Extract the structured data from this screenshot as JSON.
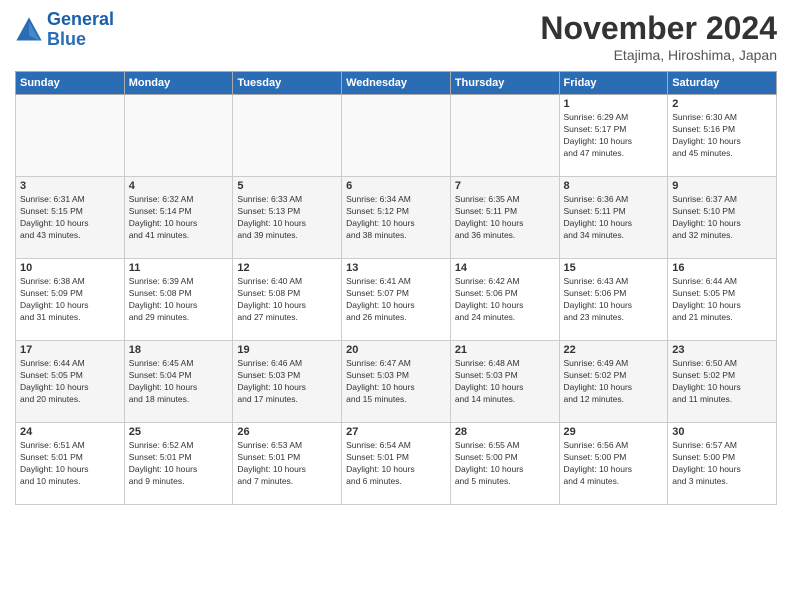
{
  "header": {
    "logo_line1": "General",
    "logo_line2": "Blue",
    "title": "November 2024",
    "subtitle": "Etajima, Hiroshima, Japan"
  },
  "days_of_week": [
    "Sunday",
    "Monday",
    "Tuesday",
    "Wednesday",
    "Thursday",
    "Friday",
    "Saturday"
  ],
  "weeks": [
    [
      {
        "day": "",
        "info": ""
      },
      {
        "day": "",
        "info": ""
      },
      {
        "day": "",
        "info": ""
      },
      {
        "day": "",
        "info": ""
      },
      {
        "day": "",
        "info": ""
      },
      {
        "day": "1",
        "info": "Sunrise: 6:29 AM\nSunset: 5:17 PM\nDaylight: 10 hours\nand 47 minutes."
      },
      {
        "day": "2",
        "info": "Sunrise: 6:30 AM\nSunset: 5:16 PM\nDaylight: 10 hours\nand 45 minutes."
      }
    ],
    [
      {
        "day": "3",
        "info": "Sunrise: 6:31 AM\nSunset: 5:15 PM\nDaylight: 10 hours\nand 43 minutes."
      },
      {
        "day": "4",
        "info": "Sunrise: 6:32 AM\nSunset: 5:14 PM\nDaylight: 10 hours\nand 41 minutes."
      },
      {
        "day": "5",
        "info": "Sunrise: 6:33 AM\nSunset: 5:13 PM\nDaylight: 10 hours\nand 39 minutes."
      },
      {
        "day": "6",
        "info": "Sunrise: 6:34 AM\nSunset: 5:12 PM\nDaylight: 10 hours\nand 38 minutes."
      },
      {
        "day": "7",
        "info": "Sunrise: 6:35 AM\nSunset: 5:11 PM\nDaylight: 10 hours\nand 36 minutes."
      },
      {
        "day": "8",
        "info": "Sunrise: 6:36 AM\nSunset: 5:11 PM\nDaylight: 10 hours\nand 34 minutes."
      },
      {
        "day": "9",
        "info": "Sunrise: 6:37 AM\nSunset: 5:10 PM\nDaylight: 10 hours\nand 32 minutes."
      }
    ],
    [
      {
        "day": "10",
        "info": "Sunrise: 6:38 AM\nSunset: 5:09 PM\nDaylight: 10 hours\nand 31 minutes."
      },
      {
        "day": "11",
        "info": "Sunrise: 6:39 AM\nSunset: 5:08 PM\nDaylight: 10 hours\nand 29 minutes."
      },
      {
        "day": "12",
        "info": "Sunrise: 6:40 AM\nSunset: 5:08 PM\nDaylight: 10 hours\nand 27 minutes."
      },
      {
        "day": "13",
        "info": "Sunrise: 6:41 AM\nSunset: 5:07 PM\nDaylight: 10 hours\nand 26 minutes."
      },
      {
        "day": "14",
        "info": "Sunrise: 6:42 AM\nSunset: 5:06 PM\nDaylight: 10 hours\nand 24 minutes."
      },
      {
        "day": "15",
        "info": "Sunrise: 6:43 AM\nSunset: 5:06 PM\nDaylight: 10 hours\nand 23 minutes."
      },
      {
        "day": "16",
        "info": "Sunrise: 6:44 AM\nSunset: 5:05 PM\nDaylight: 10 hours\nand 21 minutes."
      }
    ],
    [
      {
        "day": "17",
        "info": "Sunrise: 6:44 AM\nSunset: 5:05 PM\nDaylight: 10 hours\nand 20 minutes."
      },
      {
        "day": "18",
        "info": "Sunrise: 6:45 AM\nSunset: 5:04 PM\nDaylight: 10 hours\nand 18 minutes."
      },
      {
        "day": "19",
        "info": "Sunrise: 6:46 AM\nSunset: 5:03 PM\nDaylight: 10 hours\nand 17 minutes."
      },
      {
        "day": "20",
        "info": "Sunrise: 6:47 AM\nSunset: 5:03 PM\nDaylight: 10 hours\nand 15 minutes."
      },
      {
        "day": "21",
        "info": "Sunrise: 6:48 AM\nSunset: 5:03 PM\nDaylight: 10 hours\nand 14 minutes."
      },
      {
        "day": "22",
        "info": "Sunrise: 6:49 AM\nSunset: 5:02 PM\nDaylight: 10 hours\nand 12 minutes."
      },
      {
        "day": "23",
        "info": "Sunrise: 6:50 AM\nSunset: 5:02 PM\nDaylight: 10 hours\nand 11 minutes."
      }
    ],
    [
      {
        "day": "24",
        "info": "Sunrise: 6:51 AM\nSunset: 5:01 PM\nDaylight: 10 hours\nand 10 minutes."
      },
      {
        "day": "25",
        "info": "Sunrise: 6:52 AM\nSunset: 5:01 PM\nDaylight: 10 hours\nand 9 minutes."
      },
      {
        "day": "26",
        "info": "Sunrise: 6:53 AM\nSunset: 5:01 PM\nDaylight: 10 hours\nand 7 minutes."
      },
      {
        "day": "27",
        "info": "Sunrise: 6:54 AM\nSunset: 5:01 PM\nDaylight: 10 hours\nand 6 minutes."
      },
      {
        "day": "28",
        "info": "Sunrise: 6:55 AM\nSunset: 5:00 PM\nDaylight: 10 hours\nand 5 minutes."
      },
      {
        "day": "29",
        "info": "Sunrise: 6:56 AM\nSunset: 5:00 PM\nDaylight: 10 hours\nand 4 minutes."
      },
      {
        "day": "30",
        "info": "Sunrise: 6:57 AM\nSunset: 5:00 PM\nDaylight: 10 hours\nand 3 minutes."
      }
    ]
  ]
}
